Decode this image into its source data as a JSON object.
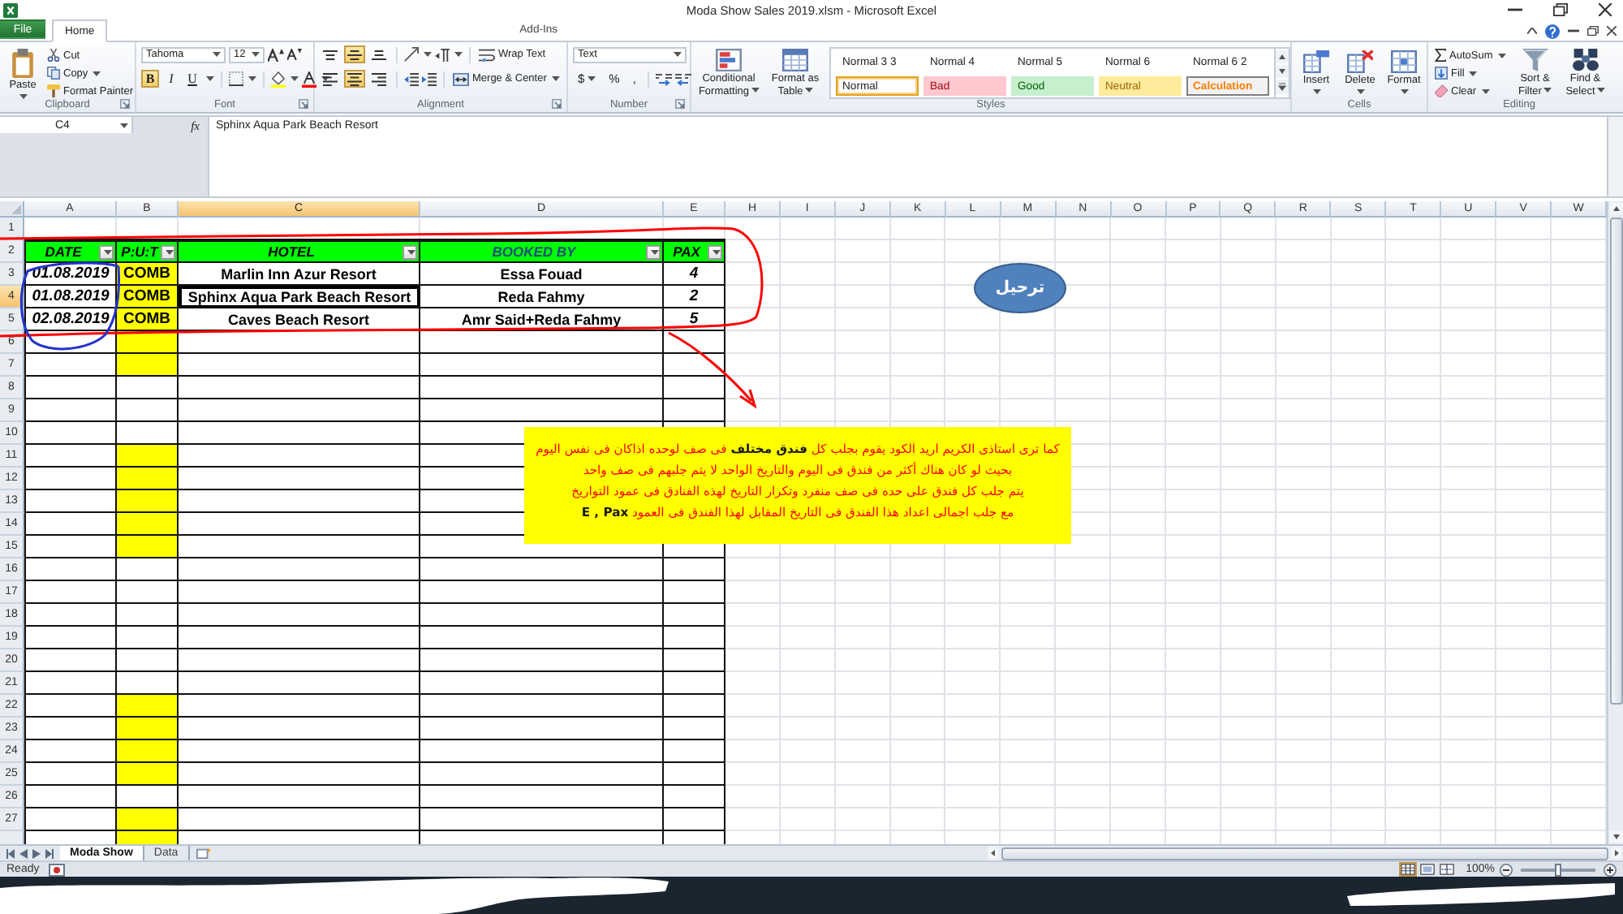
{
  "window": {
    "title": "Moda Show Sales 2019.xlsm - Microsoft Excel"
  },
  "ribbon_tabs": [
    {
      "kind": "file",
      "label": "File",
      "selected": false
    },
    {
      "kind": "tab",
      "label": "Home",
      "selected": true
    },
    {
      "kind": "tab",
      "label": "Add-Ins",
      "selected": false
    }
  ],
  "ribbon": {
    "clipboard": {
      "paste": "Paste",
      "cut": "Cut",
      "copy": "Copy",
      "format_painter": "Format Painter",
      "label": "Clipboard"
    },
    "font": {
      "name": "Tahoma",
      "size": "12",
      "styles": [
        {
          "text": "B",
          "selected": true
        },
        {
          "text": "I",
          "selected": false
        },
        {
          "text": "U",
          "selected": false
        }
      ],
      "label": "Font"
    },
    "alignment": {
      "vertical": [
        {
          "kind": "top",
          "selected": false
        },
        {
          "kind": "middle",
          "selected": true
        },
        {
          "kind": "bottom",
          "selected": false
        }
      ],
      "horizontal": [
        {
          "kind": "left",
          "selected": false
        },
        {
          "kind": "center",
          "selected": true
        },
        {
          "kind": "right",
          "selected": false
        }
      ],
      "wrap_text": "Wrap Text",
      "merge": "Merge & Center",
      "label": "Alignment"
    },
    "number": {
      "format": "Text",
      "symbols": [
        "$",
        "%",
        ","
      ],
      "label": "Number"
    },
    "styles": {
      "conditional_formatting": "Conditional Formatting",
      "format_as_table": "Format as Table",
      "gallery": [
        {
          "kind": "plain",
          "label": "Normal 3 3",
          "selected": false
        },
        {
          "kind": "plain",
          "label": "Normal 4",
          "selected": false
        },
        {
          "kind": "plain",
          "label": "Normal 5",
          "selected": false
        },
        {
          "kind": "plain",
          "label": "Normal 6",
          "selected": false
        },
        {
          "kind": "plain",
          "label": "Normal 6 2",
          "selected": false
        },
        {
          "kind": "normal",
          "label": "Normal",
          "selected": true
        },
        {
          "kind": "bad",
          "label": "Bad",
          "selected": false
        },
        {
          "kind": "good",
          "label": "Good",
          "selected": false
        },
        {
          "kind": "neutral",
          "label": "Neutral",
          "selected": false
        },
        {
          "kind": "calculation",
          "label": "Calculation",
          "selected": false
        }
      ],
      "label": "Styles"
    },
    "cells": {
      "insert": "Insert",
      "delete": "Delete",
      "format": "Format",
      "label": "Cells"
    },
    "editing": {
      "autosum": "AutoSum",
      "fill": "Fill",
      "clear": "Clear",
      "sort_filter": "Sort & Filter",
      "find_select": "Find & Select",
      "label": "Editing"
    }
  },
  "formula_bar": {
    "name_box": "C4",
    "fx": "fx",
    "content": "Sphinx Aqua Park Beach Resort"
  },
  "sheet": {
    "columns": [
      {
        "label": "A",
        "selected": false
      },
      {
        "label": "B",
        "selected": false
      },
      {
        "label": "C",
        "selected": true
      },
      {
        "label": "D",
        "selected": false
      },
      {
        "label": "E",
        "selected": false
      },
      {
        "label": "H",
        "selected": false
      },
      {
        "label": "I",
        "selected": false
      },
      {
        "label": "J",
        "selected": false
      },
      {
        "label": "K",
        "selected": false
      },
      {
        "label": "L",
        "selected": false
      },
      {
        "label": "M",
        "selected": false
      },
      {
        "label": "N",
        "selected": false
      },
      {
        "label": "O",
        "selected": false
      },
      {
        "label": "P",
        "selected": false
      },
      {
        "label": "Q",
        "selected": false
      },
      {
        "label": "R",
        "selected": false
      },
      {
        "label": "S",
        "selected": false
      },
      {
        "label": "T",
        "selected": false
      },
      {
        "label": "U",
        "selected": false
      },
      {
        "label": "V",
        "selected": false
      },
      {
        "label": "W",
        "selected": false
      }
    ],
    "rows": [
      {
        "label": "1",
        "selected": false,
        "kind": "plain"
      },
      {
        "label": "2",
        "selected": false,
        "kind": "header",
        "cells": [
          {
            "text": "DATE",
            "color": "#000000"
          },
          {
            "text": "P:U:T",
            "color": "#000000"
          },
          {
            "text": "HOTEL",
            "color": "#000000"
          },
          {
            "text": "BOOKED BY",
            "color": "#1f4e79"
          },
          {
            "text": "PAX",
            "color": "#000000"
          }
        ]
      },
      {
        "label": "3",
        "selected": false,
        "kind": "data",
        "cells": [
          {
            "text": "01.08.2019",
            "highlighted": false,
            "selected": false
          },
          {
            "text": "COMB",
            "highlighted": true,
            "selected": false
          },
          {
            "text": "Marlin Inn Azur Resort",
            "highlighted": false,
            "selected": false
          },
          {
            "text": "Essa Fouad",
            "highlighted": false,
            "selected": false
          },
          {
            "text": "4",
            "highlighted": false,
            "selected": false
          }
        ]
      },
      {
        "label": "4",
        "selected": true,
        "kind": "data",
        "cells": [
          {
            "text": "01.08.2019",
            "highlighted": false,
            "selected": false
          },
          {
            "text": "COMB",
            "highlighted": true,
            "selected": false
          },
          {
            "text": "Sphinx Aqua Park Beach Resort",
            "highlighted": false,
            "selected": true
          },
          {
            "text": "Reda Fahmy",
            "highlighted": false,
            "selected": false
          },
          {
            "text": "2",
            "highlighted": false,
            "selected": false
          }
        ]
      },
      {
        "label": "5",
        "selected": false,
        "kind": "data",
        "cells": [
          {
            "text": "02.08.2019",
            "highlighted": false,
            "selected": false
          },
          {
            "text": "COMB",
            "highlighted": true,
            "selected": false
          },
          {
            "text": "Caves Beach Resort",
            "highlighted": false,
            "selected": false
          },
          {
            "text": "Amr Said+Reda Fahmy",
            "highlighted": false,
            "selected": false
          },
          {
            "text": "5",
            "highlighted": false,
            "selected": false
          }
        ]
      },
      {
        "label": "6",
        "selected": false,
        "kind": "blank",
        "highlighted": true
      },
      {
        "label": "7",
        "selected": false,
        "kind": "blank",
        "highlighted": true
      },
      {
        "label": "8",
        "selected": false,
        "kind": "blank",
        "highlighted": false
      },
      {
        "label": "9",
        "selected": false,
        "kind": "blank",
        "highlighted": false
      },
      {
        "label": "10",
        "selected": false,
        "kind": "blank",
        "highlighted": false
      },
      {
        "label": "11",
        "selected": false,
        "kind": "blank",
        "highlighted": true
      },
      {
        "label": "12",
        "selected": false,
        "kind": "blank",
        "highlighted": true
      },
      {
        "label": "13",
        "selected": false,
        "kind": "blank",
        "highlighted": true
      },
      {
        "label": "14",
        "selected": false,
        "kind": "blank",
        "highlighted": true
      },
      {
        "label": "15",
        "selected": false,
        "kind": "blank",
        "highlighted": true
      },
      {
        "label": "16",
        "selected": false,
        "kind": "blank",
        "highlighted": false
      },
      {
        "label": "17",
        "selected": false,
        "kind": "blank",
        "highlighted": false
      },
      {
        "label": "18",
        "selected": false,
        "kind": "blank",
        "highlighted": false
      },
      {
        "label": "19",
        "selected": false,
        "kind": "blank",
        "highlighted": false
      },
      {
        "label": "20",
        "selected": false,
        "kind": "blank",
        "highlighted": false
      },
      {
        "label": "21",
        "selected": false,
        "kind": "blank",
        "highlighted": false
      },
      {
        "label": "22",
        "selected": false,
        "kind": "blank",
        "highlighted": true
      },
      {
        "label": "23",
        "selected": false,
        "kind": "blank",
        "highlighted": true
      },
      {
        "label": "24",
        "selected": false,
        "kind": "blank",
        "highlighted": true
      },
      {
        "label": "25",
        "selected": false,
        "kind": "blank",
        "highlighted": true
      },
      {
        "label": "26",
        "selected": false,
        "kind": "blank",
        "highlighted": false
      },
      {
        "label": "27",
        "selected": false,
        "kind": "blank",
        "highlighted": true
      },
      {
        "selected": false,
        "kind": "blank",
        "highlighted": true
      }
    ]
  },
  "note": {
    "lines": [
      "كما ترى استاذى الكريم اريد الكود يقوم بجلب كل **فندق مختلف** فى صف لوحده اذاكان فى نفس اليوم",
      "بحيث لو كان هناك أكثر من فندق فى اليوم والتاريخ الواحد لا يتم جلبهم فى صف واحد",
      "يتم جلب كل فندق على حده فى صف منفرد وتكرار التاريخ لهذه الفنادق فى عمود التواريخ",
      "مع جلب اجمالى اعداد هذا الفندق فى التاريخ المقابل لهذا الفندق فى العمود **E , Pax**"
    ]
  },
  "shape_button": {
    "text": "ترحيل"
  },
  "sheet_tabs": [
    {
      "label": "Moda Show",
      "selected": true
    },
    {
      "label": "Data",
      "selected": false
    }
  ],
  "status_bar": {
    "text": "Ready",
    "views": [
      {
        "kind": "normal",
        "selected": true
      },
      {
        "kind": "page_layout",
        "selected": false
      },
      {
        "kind": "page_break",
        "selected": false
      }
    ],
    "zoom": "100%",
    "zoom_slider": {
      "level": 0.5
    }
  }
}
